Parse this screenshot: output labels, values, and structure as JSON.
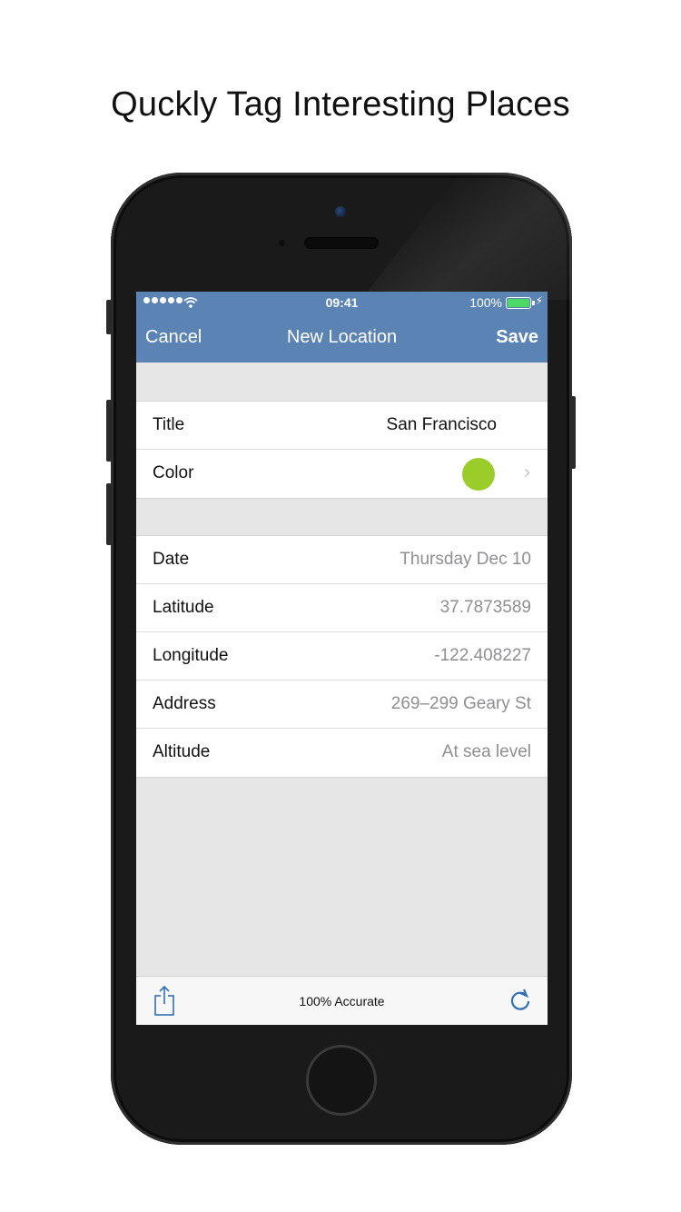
{
  "headline": "Quckly Tag Interesting Places",
  "status_bar": {
    "time": "09:41",
    "battery_percent": "100%",
    "battery_level": 1.0,
    "signal_bars": 5
  },
  "navbar": {
    "cancel_label": "Cancel",
    "title": "New Location",
    "save_label": "Save",
    "color": "#5b84b5"
  },
  "details": {
    "title_label": "Title",
    "title_value": "San Francisco",
    "color_label": "Color",
    "color_value": "#9acd2a"
  },
  "info": {
    "rows": [
      {
        "label": "Date",
        "value": "Thursday Dec 10"
      },
      {
        "label": "Latitude",
        "value": "37.7873589"
      },
      {
        "label": "Longitude",
        "value": "-122.408227"
      },
      {
        "label": "Address",
        "value": "269–299 Geary St"
      },
      {
        "label": "Altitude",
        "value": "At sea level"
      }
    ]
  },
  "toolbar": {
    "accuracy_text": "100% Accurate",
    "share_icon": "share-icon",
    "refresh_icon": "refresh-icon",
    "icon_color": "#2f6fb5"
  }
}
